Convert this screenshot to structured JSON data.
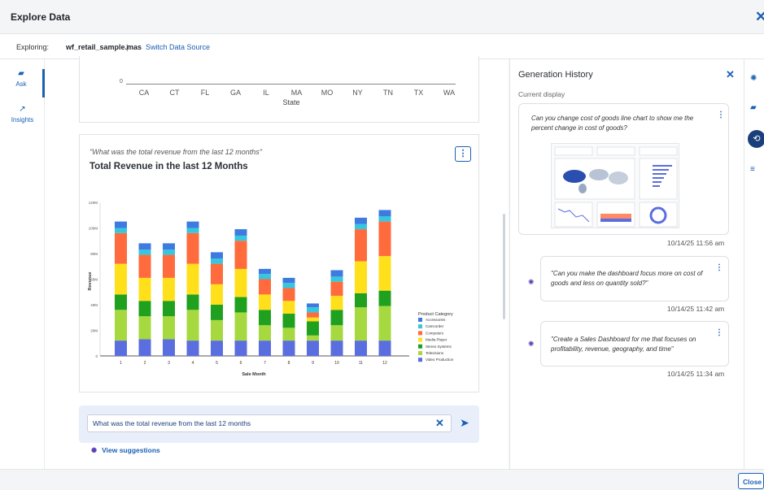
{
  "header": {
    "title": "Explore Data"
  },
  "subbar": {
    "exploring_label": "Exploring:",
    "file": "wf_retail_sample.mas",
    "separator": "|",
    "switch": "Switch Data Source"
  },
  "nav": {
    "ask": "Ask",
    "insights": "Insights"
  },
  "prev_chart": {
    "zero": "0",
    "states": [
      "CA",
      "CT",
      "FL",
      "GA",
      "IL",
      "MA",
      "MO",
      "NY",
      "TN",
      "TX",
      "WA"
    ],
    "xlabel": "State"
  },
  "card": {
    "quote": "\"What was the total revenue from the last 12 months\"",
    "title": "Total Revenue in the last 12 Months"
  },
  "chart_data": {
    "type": "bar",
    "stacked": true,
    "xlabel": "Sale Month",
    "ylabel": "Revenue",
    "ylim": [
      0,
      120
    ],
    "yticks": [
      "0",
      "20M",
      "40M",
      "60M",
      "80M",
      "100M",
      "120M"
    ],
    "categories": [
      "1",
      "2",
      "3",
      "4",
      "5",
      "6",
      "7",
      "8",
      "9",
      "10",
      "11",
      "12"
    ],
    "legend_title": "Product Category",
    "legend_position": "right",
    "series": [
      {
        "name": "Video Production",
        "color": "#5b6ee0",
        "values": [
          12,
          13,
          13,
          12,
          12,
          12,
          12,
          12,
          12,
          12,
          12,
          12
        ]
      },
      {
        "name": "Televisions",
        "color": "#a6d83f",
        "values": [
          24,
          18,
          18,
          24,
          16,
          22,
          12,
          10,
          4,
          12,
          26,
          27
        ]
      },
      {
        "name": "Stereo Systems",
        "color": "#1fa01f",
        "values": [
          12,
          12,
          12,
          12,
          12,
          12,
          12,
          11,
          11,
          12,
          11,
          12
        ]
      },
      {
        "name": "Media Player",
        "color": "#ffe01a",
        "values": [
          24,
          18,
          18,
          24,
          16,
          22,
          12,
          10,
          3,
          11,
          25,
          27
        ]
      },
      {
        "name": "Computers",
        "color": "#ff6b3d",
        "values": [
          24,
          18,
          18,
          24,
          16,
          22,
          12,
          10,
          4,
          11,
          25,
          27
        ]
      },
      {
        "name": "Camcorder",
        "color": "#36c6de",
        "values": [
          4,
          4,
          4,
          4,
          4,
          4,
          4,
          4,
          4,
          4,
          4,
          4
        ]
      },
      {
        "name": "Accessories",
        "color": "#3d7be0",
        "values": [
          5,
          5,
          5,
          5,
          5,
          5,
          4,
          4,
          3,
          5,
          5,
          5
        ]
      }
    ]
  },
  "ask": {
    "value": "What was the total revenue from the last 12 months",
    "suggestions": "View suggestions"
  },
  "history": {
    "title": "Generation History",
    "current": "Current display",
    "items": [
      {
        "text": "Can you change cost of goods line chart to show me the percent change in cost of goods?",
        "time": "10/14/25 11:56 am"
      },
      {
        "text": "\"Can you make the dashboard focus more on cost of goods and less on quantity sold?\"",
        "time": "10/14/25 11:42 am"
      },
      {
        "text": "\"Create a Sales Dashboard for me that focuses on profitability, revenue, geography, and time\"",
        "time": "10/14/25 11:34 am"
      }
    ]
  },
  "footer": {
    "close": "Close"
  }
}
